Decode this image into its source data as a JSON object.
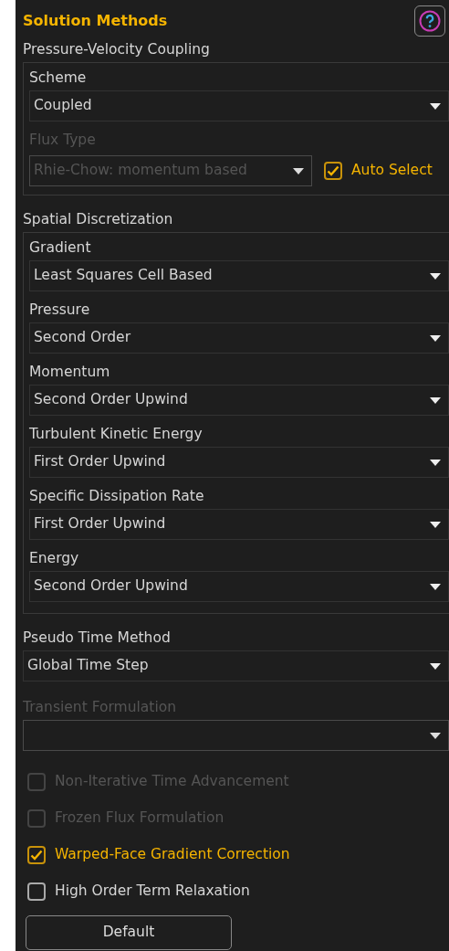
{
  "title": "Solution Methods",
  "groups": [
    {
      "label": "Pressure-Velocity Coupling",
      "fields": [
        {
          "label": "Scheme",
          "value": "Coupled",
          "disabled": false
        },
        {
          "label": "Flux Type",
          "value": "Rhie-Chow: momentum based",
          "disabled": true,
          "auto_select": {
            "label": "Auto Select",
            "checked": true
          }
        }
      ]
    },
    {
      "label": "Spatial Discretization",
      "fields": [
        {
          "label": "Gradient",
          "value": "Least Squares Cell Based",
          "disabled": false
        },
        {
          "label": "Pressure",
          "value": "Second Order",
          "disabled": false
        },
        {
          "label": "Momentum",
          "value": "Second Order Upwind",
          "disabled": false
        },
        {
          "label": "Turbulent Kinetic Energy",
          "value": "First Order Upwind",
          "disabled": false
        },
        {
          "label": "Specific Dissipation Rate",
          "value": "First Order Upwind",
          "disabled": false
        },
        {
          "label": "Energy",
          "value": "Second Order Upwind",
          "disabled": false
        }
      ]
    }
  ],
  "fields": [
    {
      "label": "Pseudo Time Method",
      "value": "Global Time Step",
      "disabled": false
    },
    {
      "label": "Transient Formulation",
      "disabled": true
    }
  ],
  "options": [
    {
      "label": "Non-Iterative Time Advancement",
      "checked": false,
      "disabled": true
    },
    {
      "label": "Frozen Flux Formulation",
      "checked": false,
      "disabled": true
    },
    {
      "label": "Warped-Face Gradient Correction",
      "checked": true,
      "disabled": false
    },
    {
      "label": "High Order Term Relaxation",
      "checked": false,
      "disabled": false
    }
  ],
  "default_button": "Default"
}
